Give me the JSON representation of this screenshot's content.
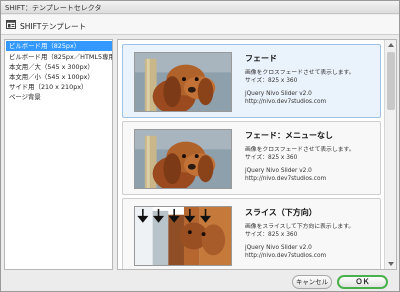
{
  "window": {
    "title": "SHIFT：テンプレートセレクタ"
  },
  "header": {
    "title": "SHIFTテンプレート",
    "icon": "template-window-icon"
  },
  "sidebar": {
    "items": [
      {
        "label": "ビルボード用（825px）",
        "selected": true
      },
      {
        "label": "ビルボード用（825px／HTML5専用）",
        "selected": false
      },
      {
        "label": "本文用／大（545 x 300px）",
        "selected": false
      },
      {
        "label": "本文用／小（545 x 100px）",
        "selected": false
      },
      {
        "label": "サイド用（210 x 210px）",
        "selected": false
      },
      {
        "label": "ページ背景",
        "selected": false
      }
    ]
  },
  "templates": [
    {
      "title": "フェード",
      "description": "画像をクロスフェードさせて表示します。",
      "size": "サイズ：825 x 360",
      "plugin": "jQuery Nivo Slider v2.0",
      "url": "http://nivo.dev7studios.com"
    },
    {
      "title": "フェード：メニューなし",
      "description": "画像をクロスフェードさせて表示します。",
      "size": "サイズ：825 x 360",
      "plugin": "jQuery Nivo Slider v2.0",
      "url": "http://nivo.dev7studios.com"
    },
    {
      "title": "スライス（下方向）",
      "description": "画像をスライスして下方向に表示します。",
      "size": "サイズ：825 x 360",
      "plugin": "jQuery Nivo Slider v2.0",
      "url": "http://nivo.dev7studios.com"
    }
  ],
  "footer": {
    "cancel_label": "キャンセル",
    "ok_label": "ＯＫ"
  }
}
